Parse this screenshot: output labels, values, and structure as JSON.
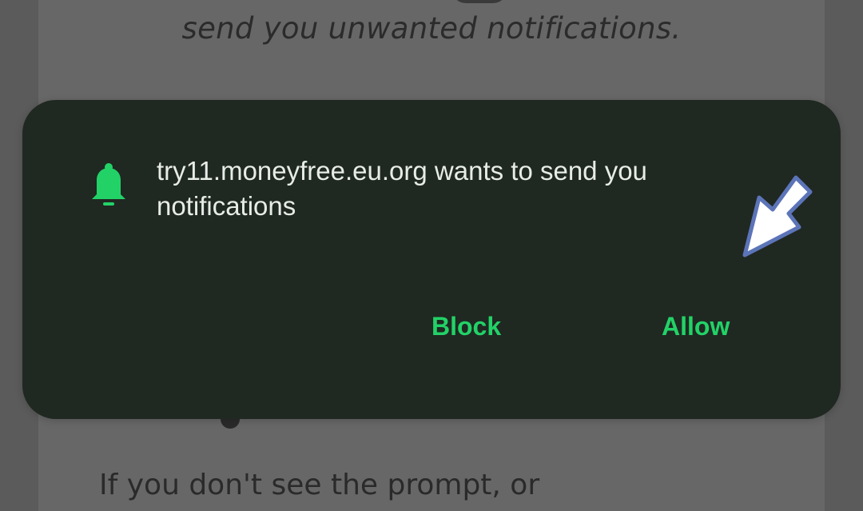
{
  "background": {
    "instruction_text": "send you unwanted notifications.",
    "help_text": "If you don't see the prompt, or"
  },
  "permission_prompt": {
    "message": "try11.moneyfree.eu.org wants to send you notifications",
    "block_label": "Block",
    "allow_label": "Allow",
    "icon": "bell-icon",
    "accent_color": "#22d267",
    "panel_color": "#202822"
  },
  "overlay": {
    "icon": "pointer-arrow-icon"
  }
}
